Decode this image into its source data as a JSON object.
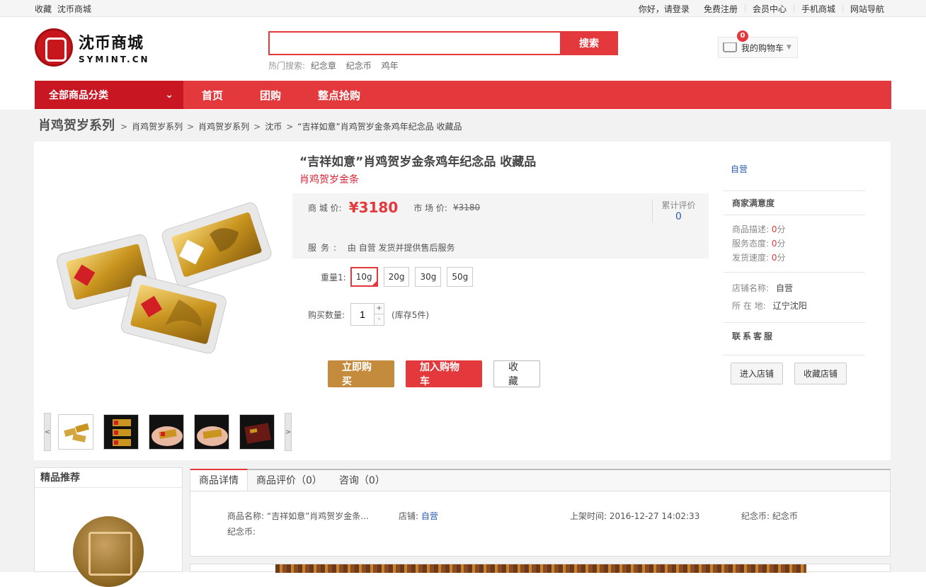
{
  "topbar": {
    "left": [
      "收藏",
      "沈币商城"
    ],
    "greeting": "你好，请登录",
    "register": "免费注册",
    "member": "会员中心",
    "mobile": "手机商城",
    "sitemap": "网站导航"
  },
  "logo": {
    "cn": "沈币商城",
    "en": "SYMINT.CN"
  },
  "search": {
    "value": "",
    "button": "搜索",
    "hot_label": "热门搜索:",
    "hot": [
      "纪念章",
      "纪念币",
      "鸡年"
    ]
  },
  "cart": {
    "count": "0",
    "label": "我的购物车"
  },
  "nav": {
    "category": "全部商品分类",
    "items": [
      "首页",
      "团购",
      "整点抢购"
    ]
  },
  "breadcrumb": {
    "title": "肖鸡贺岁系列",
    "items": [
      "肖鸡贺岁系列",
      "肖鸡贺岁系列",
      "沈币",
      "“吉祥如意”肖鸡贺岁金条鸡年纪念品 收藏品"
    ],
    "sep": ">"
  },
  "product": {
    "title": "“吉祥如意”肖鸡贺岁金条鸡年纪念品 收藏品",
    "subtitle": "肖鸡贺岁金条",
    "mall_price_label": "商 城 价:",
    "price": "¥3180",
    "market_price_label": "市 场 价:",
    "market_price": "¥3180",
    "rating_label": "累计评价",
    "rating_value": "0",
    "service_label": "服务:",
    "service_text": "由 自营 发货并提供售后服务",
    "spec_label": "重量1:",
    "specs": [
      "10g",
      "20g",
      "30g",
      "50g"
    ],
    "selected_spec": "10g",
    "qty_label": "购买数量:",
    "qty": "1",
    "plus": "+",
    "minus": "-",
    "stock": "(库存5件)",
    "buy_now": "立即购买",
    "add_cart": "加入购物车",
    "favorite": "收藏"
  },
  "thumbs": {
    "prev": "<",
    "next": ">",
    "count": 5
  },
  "shop": {
    "type": "自营",
    "satisfaction": "商家满意度",
    "scores": [
      {
        "label": "商品描述:",
        "value": "0",
        "unit": "分"
      },
      {
        "label": "服务态度:",
        "value": "0",
        "unit": "分"
      },
      {
        "label": "发货速度:",
        "value": "0",
        "unit": "分"
      }
    ],
    "name_label": "店铺名称:",
    "name": "自营",
    "location_label": "所 在 地:",
    "location": "辽宁沈阳",
    "contact": "联系客服",
    "enter": "进入店铺",
    "fav": "收藏店铺"
  },
  "recommend": {
    "title": "精品推荐"
  },
  "tabs": [
    {
      "label": "商品详情"
    },
    {
      "label": "商品评价（0）"
    },
    {
      "label": "咨询（0）"
    }
  ],
  "attributes": {
    "name_label": "商品名称:",
    "name": "“吉祥如意”肖鸡贺岁金条...",
    "shop_label": "店铺:",
    "shop": "自营",
    "time_label": "上架时间:",
    "time": "2016-12-27 14:02:33",
    "coin_label": "纪念币:",
    "coin": "纪念币",
    "coin2_label": "纪念币:"
  },
  "colors": {
    "brand": "#e4393c",
    "buy": "#c58b3d",
    "link": "#2a5caa"
  }
}
